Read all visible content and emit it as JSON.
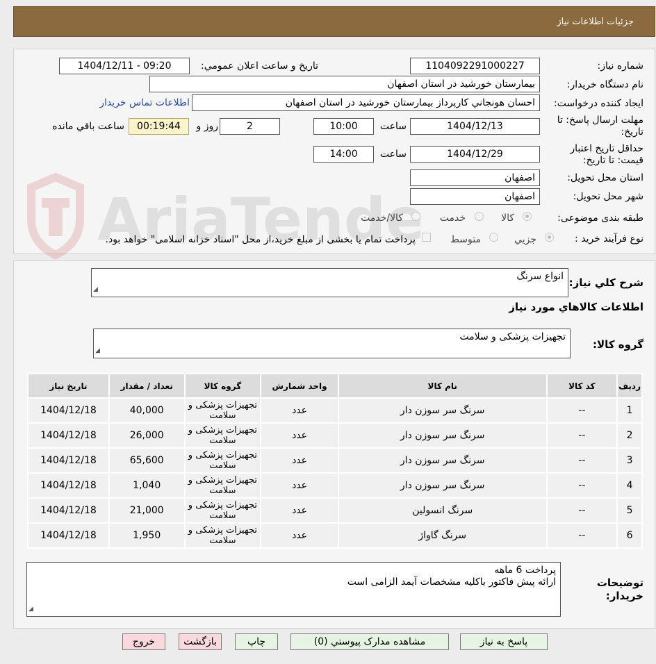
{
  "header": {
    "title": "جزئيات اطلاعات نياز"
  },
  "watermark": {
    "text": "AriaTender.neT"
  },
  "form": {
    "need_number_label": "شماره نياز:",
    "need_number": "1104092291000227",
    "announce_label": "تاريخ و ساعت اعلان عمومي:",
    "announce_value": "1404/12/11 - 09:20",
    "buyer_org_label": "نام دستگاه خريدار:",
    "buyer_org": "بيمارستان خورشيد در استان اصفهان",
    "requester_label": "ايجاد کننده درخواست:",
    "requester": "احسان هونجاني کارپرداز بيمارستان خورشيد در استان اصفهان",
    "contact_link": "اطلاعات تماس خريدار",
    "deadline_label": "مهلت ارسال پاسخ: تا تاريخ:",
    "deadline_date": "1404/12/13",
    "time_word": "ساعت",
    "deadline_time": "10:00",
    "days": "2",
    "days_word": "روز و",
    "remaining_timer": "00:19:44",
    "remaining_word": "ساعت باقي مانده",
    "validity_label": "حداقل تاريخ اعتبار قيمت: تا تاريخ:",
    "validity_date": "1404/12/29",
    "validity_time": "14:00",
    "province_label": "استان محل تحويل:",
    "province": "اصفهان",
    "city_label": "شهر محل تحويل:",
    "city": "اصفهان",
    "category_label": "طبقه بندی موضوعی:",
    "category_options": [
      "کالا",
      "خدمت",
      "کالا/خدمت"
    ],
    "purchase_type_label": "نوع فرآيند خريد :",
    "purchase_type_options": [
      "جزيي",
      "متوسط"
    ],
    "purchase_note": "پرداخت تمام يا بخشی از مبلغ خريد،از محل \"اسناد خزانه اسلامی\" خواهد بود."
  },
  "summary": {
    "label": "شرح کلي نياز:",
    "value": "انواع سرنگ",
    "items_heading": "اطلاعات کالاهاي مورد نياز",
    "group_label": "گروه کالا:",
    "group_value": "تجهيزات پزشکی و سلامت"
  },
  "table": {
    "headers": [
      "رديف",
      "کد کالا",
      "نام کالا",
      "واحد شمارش",
      "گروه کالا",
      "تعداد / مقدار",
      "تاريخ نياز"
    ],
    "rows": [
      {
        "row": "1",
        "code": "--",
        "name": "سرنگ سر سوزن دار",
        "unit": "عدد",
        "group": "تجهيزات پزشکی و سلامت",
        "qty": "40,000",
        "date": "1404/12/18"
      },
      {
        "row": "2",
        "code": "--",
        "name": "سرنگ سر سوزن دار",
        "unit": "عدد",
        "group": "تجهيزات پزشکی و سلامت",
        "qty": "26,000",
        "date": "1404/12/18"
      },
      {
        "row": "3",
        "code": "--",
        "name": "سرنگ سر سوزن دار",
        "unit": "عدد",
        "group": "تجهيزات پزشکی و سلامت",
        "qty": "65,600",
        "date": "1404/12/18"
      },
      {
        "row": "4",
        "code": "--",
        "name": "سرنگ سر سوزن دار",
        "unit": "عدد",
        "group": "تجهيزات پزشکی و سلامت",
        "qty": "1,040",
        "date": "1404/12/18"
      },
      {
        "row": "5",
        "code": "--",
        "name": "سرنگ انسولين",
        "unit": "عدد",
        "group": "تجهيزات پزشکی و سلامت",
        "qty": "21,000",
        "date": "1404/12/18"
      },
      {
        "row": "6",
        "code": "--",
        "name": "سرنگ گاواژ",
        "unit": "عدد",
        "group": "تجهيزات پزشکی و سلامت",
        "qty": "1,950",
        "date": "1404/12/18"
      }
    ]
  },
  "buyer_notes": {
    "label": "توضيحات خريدار:",
    "line1": "پرداخت 6 ماهه",
    "line2": "ارائه پيش فاکتور باکليه مشخصات آيمد الزامی است"
  },
  "buttons": {
    "reply": "پاسخ به نياز",
    "attachments": "مشاهده مدارک پيوستي (0)",
    "print": "چاپ",
    "back": "بازگشت",
    "exit": "خروج"
  }
}
